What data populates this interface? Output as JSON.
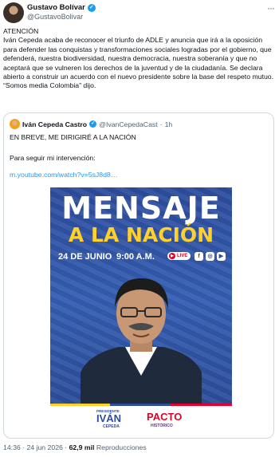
{
  "author": {
    "display_name": "Gustavo Bolívar",
    "handle": "@GustavoBolivar",
    "avatar_icon": "user-avatar",
    "more_icon": "more-dots-icon"
  },
  "tweet": {
    "text": "ATENCIÓN\nIván Cepeda acaba de reconocer el triunfo de ADLE y anuncia que irá a la oposición para defender las conquistas y transformaciones sociales logradas por el gobierno, que defenderá, nuestra biodiversidad, nuestra democracia, nuestra soberanía y que no aceptará que se vulneren los derechos de la juventud y de la ciudadanía. Se declara abierto a construir un acuerdo con el nuevo presidente sobre la base del respeto mutuo.\n“Somos media Colombia” dijo."
  },
  "quote": {
    "display_name": "Iván Cepeda Castro",
    "handle": "@IvanCepedaCast",
    "separator": "·",
    "time": "1h",
    "line1": "EN BREVE, ME DIRIGIRÉ A LA NACIÓN",
    "line2": "Para seguir mi intervención:",
    "link": "m.youtube.com/watch?v=5sJ8d8…"
  },
  "poster": {
    "title_line1": "MENSAJE",
    "title_line2": "A LA NACIÓN",
    "date": "24 DE JUNIO",
    "time": "9:00 A.M.",
    "live": "LIVE",
    "footer_small": "PRESIDENTE",
    "footer_name": "IVÁN",
    "footer_surname": "CEPEDA",
    "party_name": "PACTO",
    "party_sub": "HISTÓRICO",
    "colors": {
      "blue": "#2d4d9d",
      "yellow": "#ffd12a",
      "red": "#e4002b"
    }
  },
  "footer": {
    "timestamp": "14:36 · 24 jun 2026 · ",
    "views": "62,9 mil",
    "views_label": " Reproducciones"
  }
}
